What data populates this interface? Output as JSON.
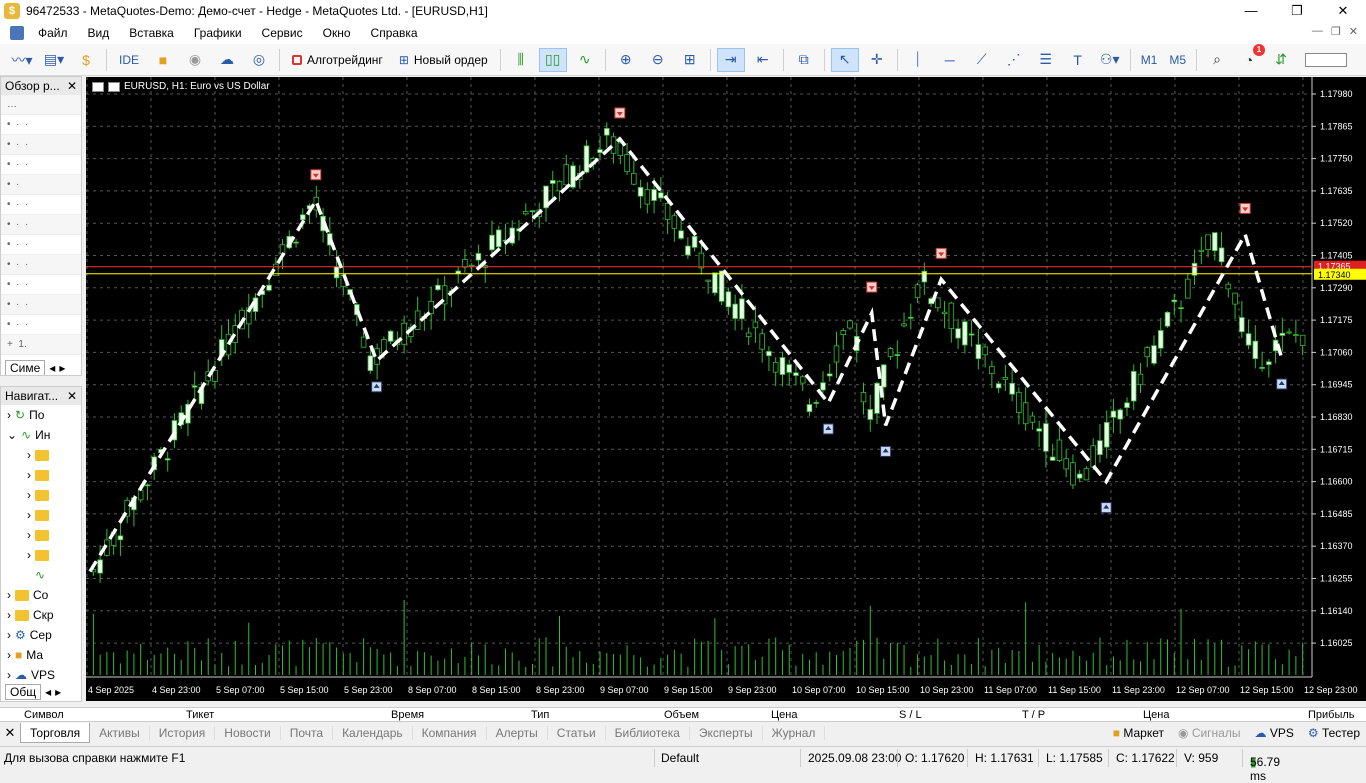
{
  "window": {
    "title": "96472533 - MetaQuotes-Demo: Демо-счет - Hedge - MetaQuotes Ltd. - [EURUSD,H1]",
    "minimize": "—",
    "maximize": "❐",
    "close": "✕"
  },
  "menu": [
    "Файл",
    "Вид",
    "Вставка",
    "Графики",
    "Сервис",
    "Окно",
    "Справка"
  ],
  "toolbar": {
    "ide": "IDE",
    "algotrading": "Алготрейдинг",
    "new_order": "Новый ордер",
    "tf_m1": "M1",
    "tf_m5": "M5",
    "notification_count": "1"
  },
  "market_watch": {
    "title": "Обзор р...",
    "tab": "Симе"
  },
  "navigator": {
    "title": "Навигат...",
    "items": [
      "По",
      "Ин",
      "Co",
      "Скр",
      "Сер",
      "Ма",
      "VPS"
    ],
    "tab": "Общ"
  },
  "chart": {
    "label": "EURUSD, H1:  Euro vs US Dollar",
    "bid_line_color": "#ffff00",
    "ask_line_color": "#ff3030",
    "price_labels": [
      "1.17980",
      "1.17865",
      "1.17750",
      "1.17635",
      "1.17520",
      "1.17405",
      "1.17290",
      "1.17175",
      "1.17060",
      "1.16945",
      "1.16830",
      "1.16715",
      "1.16600",
      "1.16485",
      "1.16370",
      "1.16255",
      "1.16140",
      "1.16025"
    ],
    "time_labels": [
      "4 Sep 2025",
      "4 Sep 23:00",
      "5 Sep 07:00",
      "5 Sep 15:00",
      "5 Sep 23:00",
      "8 Sep 07:00",
      "8 Sep 15:00",
      "8 Sep 23:00",
      "9 Sep 07:00",
      "9 Sep 15:00",
      "9 Sep 23:00",
      "10 Sep 07:00",
      "10 Sep 15:00",
      "10 Sep 23:00",
      "11 Sep 07:00",
      "11 Sep 15:00",
      "11 Sep 23:00",
      "12 Sep 07:00",
      "12 Sep 15:00",
      "12 Sep 23:00"
    ],
    "ask_price": "1.17365",
    "bid_price": "1.17340",
    "zigzag": [
      {
        "t": 0,
        "p": 1.1628
      },
      {
        "t": 13,
        "p": 1.176
      },
      {
        "t": 16.5,
        "p": 1.1703
      },
      {
        "t": 30.5,
        "p": 1.1782
      },
      {
        "t": 42.5,
        "p": 1.1688
      },
      {
        "t": 45,
        "p": 1.172
      },
      {
        "t": 45.8,
        "p": 1.168
      },
      {
        "t": 49,
        "p": 1.1732
      },
      {
        "t": 58.5,
        "p": 1.166
      },
      {
        "t": 66.5,
        "p": 1.1748
      },
      {
        "t": 68.6,
        "p": 1.1704
      }
    ],
    "fractal_up": [
      13,
      30.5,
      45,
      49,
      66.5
    ],
    "fractal_down": [
      16.5,
      42.5,
      45.8,
      58.5,
      68.6
    ]
  },
  "terminal": {
    "columns": [
      "Символ",
      "Тикет",
      "Время",
      "Тип",
      "Объем",
      "Цена",
      "S / L",
      "T / P",
      "Цена",
      "Прибыль"
    ],
    "tabs": [
      "Торговля",
      "Активы",
      "История",
      "Новости",
      "Почта",
      "Календарь",
      "Компания",
      "Алерты",
      "Статьи",
      "Библиотека",
      "Эксперты",
      "Журнал"
    ],
    "right": {
      "market": "Маркет",
      "signals": "Сигналы",
      "vps": "VPS",
      "tester": "Тестер"
    }
  },
  "status": {
    "help": "Для вызова справки нажмите F1",
    "profile": "Default",
    "datetime": "2025.09.08 23:00",
    "open": "O: 1.17620",
    "high": "H: 1.17631",
    "low": "L: 1.17585",
    "close": "C: 1.17622",
    "volume": "V: 959",
    "ping": "56.79 ms"
  }
}
